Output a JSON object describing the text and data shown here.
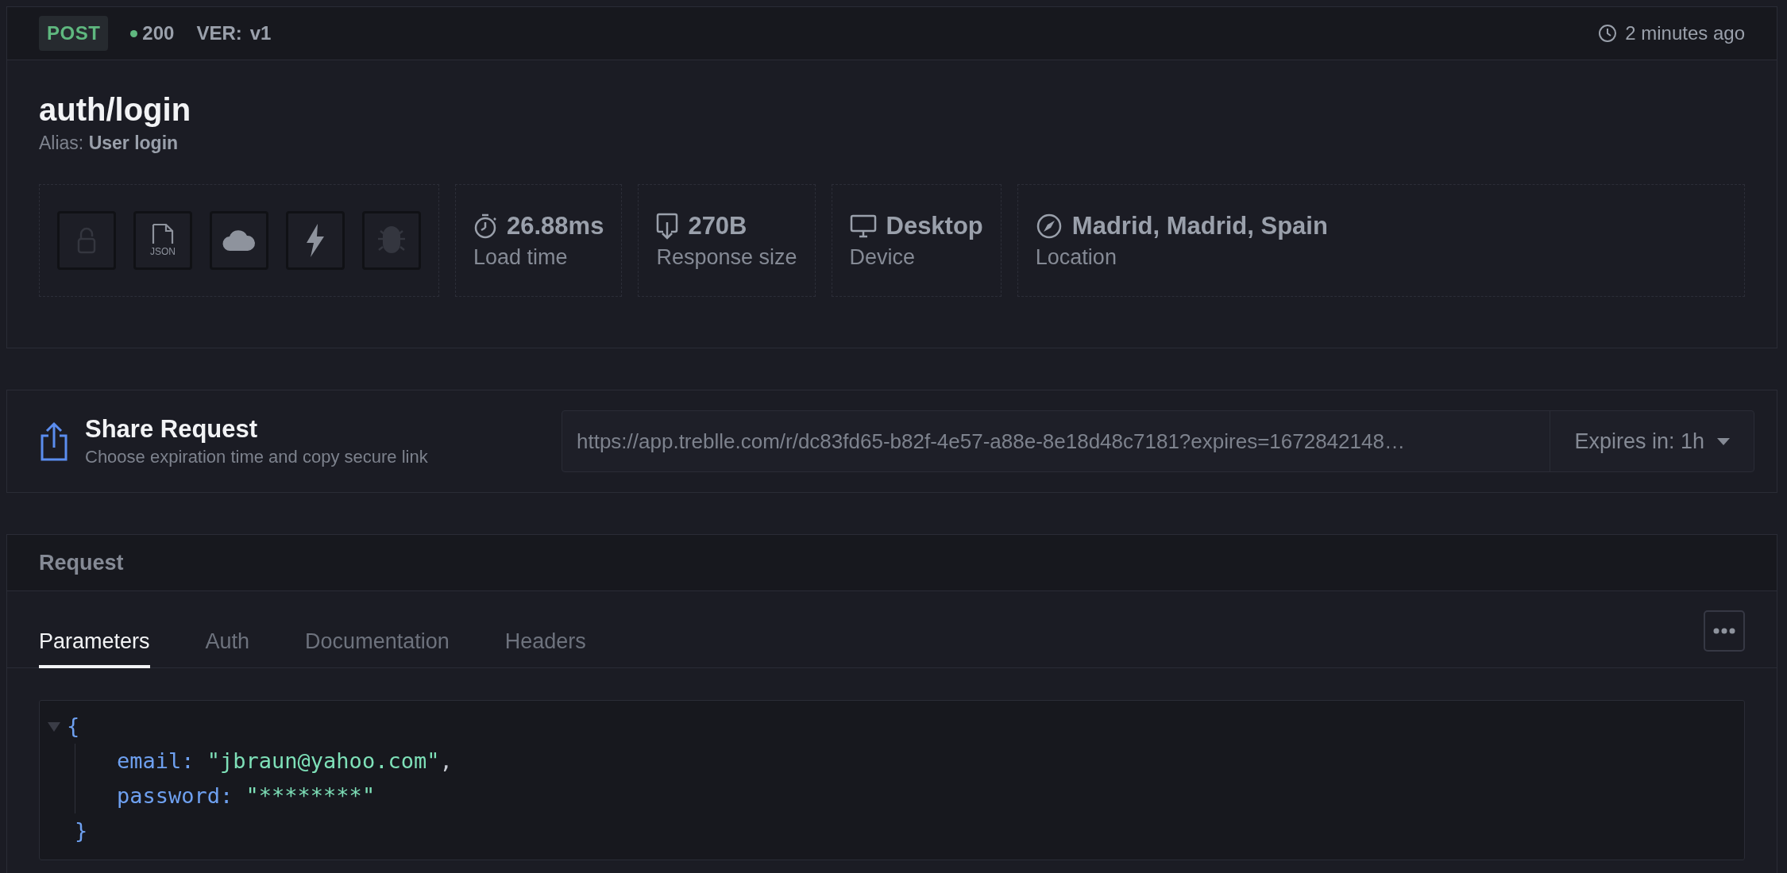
{
  "request_bar": {
    "method": "POST",
    "status": "200",
    "version_label": "VER:",
    "version": "v1",
    "time": "2 minutes ago"
  },
  "endpoint": {
    "path": "auth/login",
    "alias_label": "Alias:",
    "alias": "User login"
  },
  "features": [
    {
      "kind": "lock",
      "enabled": false
    },
    {
      "kind": "json",
      "label": "JSON",
      "enabled": true
    },
    {
      "kind": "cloud",
      "enabled": true
    },
    {
      "kind": "bolt",
      "enabled": true
    },
    {
      "kind": "bug",
      "enabled": false
    }
  ],
  "stats": [
    {
      "kind": "timer",
      "value": "26.88ms",
      "label": "Load time"
    },
    {
      "kind": "download",
      "value": "270B",
      "label": "Response size"
    },
    {
      "kind": "monitor",
      "value": "Desktop",
      "label": "Device"
    },
    {
      "kind": "compass",
      "value": "Madrid, Madrid, Spain",
      "label": "Location"
    }
  ],
  "share": {
    "title": "Share Request",
    "subtitle": "Choose expiration time and copy secure link",
    "url": "https://app.treblle.com/r/dc83fd65-b82f-4e57-a88e-8e18d48c7181?expires=1672842148…",
    "expires": "Expires in: 1h"
  },
  "request": {
    "title": "Request",
    "tabs": [
      {
        "label": "Parameters",
        "selected": true
      },
      {
        "label": "Auth",
        "selected": false
      },
      {
        "label": "Documentation",
        "selected": false
      },
      {
        "label": "Headers",
        "selected": false
      }
    ],
    "code": {
      "expanded": true,
      "open": "{",
      "close": "}",
      "entries": [
        {
          "key": "email:",
          "value": "\"jbraun@yahoo.com\"",
          "suffix": ","
        },
        {
          "key": "password:",
          "value": "\"********\""
        }
      ]
    }
  }
}
